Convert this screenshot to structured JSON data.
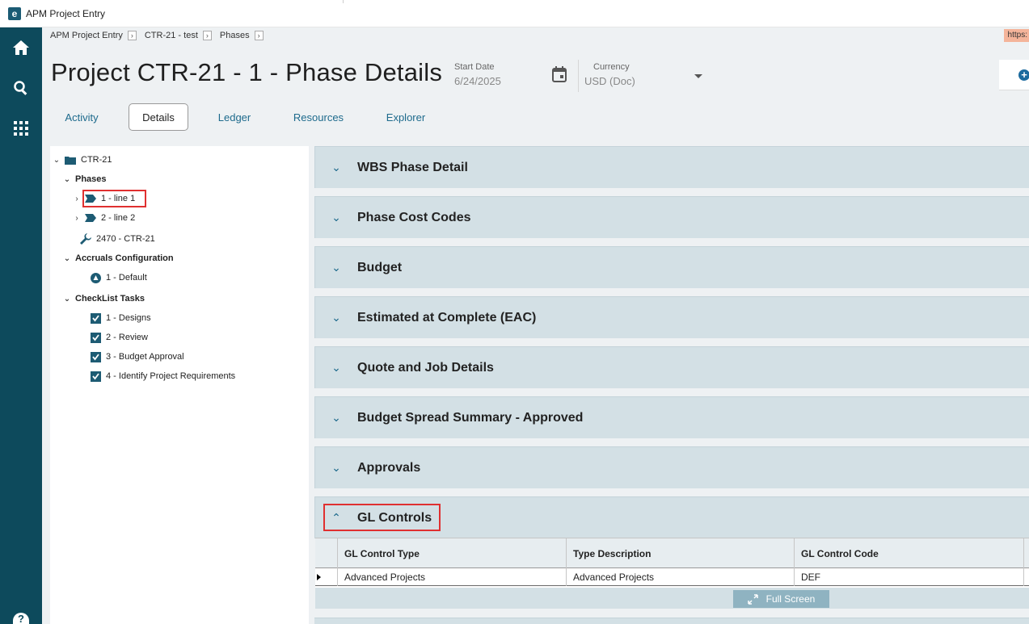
{
  "window": {
    "title": "APM Project Entry",
    "app_icon": "e"
  },
  "rail": {
    "items": [
      "home-icon",
      "search-icon",
      "apps-grid-icon"
    ],
    "help": "?"
  },
  "breadcrumb": [
    {
      "label": "APM Project Entry"
    },
    {
      "label": "CTR-21 - test"
    },
    {
      "label": "Phases"
    }
  ],
  "url_badge": "https:",
  "page_title": "Project CTR-21 - 1 - Phase Details",
  "start_date": {
    "label": "Start Date",
    "value": "6/24/2025"
  },
  "currency": {
    "label": "Currency",
    "value": "USD (Doc)"
  },
  "tabs": [
    {
      "label": "Activity",
      "active": false
    },
    {
      "label": "Details",
      "active": true
    },
    {
      "label": "Ledger",
      "active": false
    },
    {
      "label": "Resources",
      "active": false
    },
    {
      "label": "Explorer",
      "active": false
    }
  ],
  "tree": {
    "root": "CTR-21",
    "phases_label": "Phases",
    "phases": [
      "1 - line 1",
      "2 - line 2"
    ],
    "tool": "2470 - CTR-21",
    "accruals_label": "Accruals Configuration",
    "accruals": [
      "1 - Default"
    ],
    "checklist_label": "CheckList Tasks",
    "checklist": [
      "1 - Designs",
      "2 - Review",
      "3 - Budget Approval",
      "4 - Identify Project Requirements"
    ]
  },
  "sections": [
    {
      "label": "WBS Phase Detail",
      "expanded": false
    },
    {
      "label": "Phase Cost Codes",
      "expanded": false
    },
    {
      "label": "Budget",
      "expanded": false
    },
    {
      "label": "Estimated at Complete (EAC)",
      "expanded": false
    },
    {
      "label": "Quote and Job Details",
      "expanded": false
    },
    {
      "label": "Budget Spread Summary - Approved",
      "expanded": false
    },
    {
      "label": "Approvals",
      "expanded": false
    },
    {
      "label": "GL Controls",
      "expanded": true
    }
  ],
  "gl_grid": {
    "columns": [
      "GL Control Type",
      "Type Description",
      "GL Control Code"
    ],
    "rows": [
      [
        "Advanced Projects",
        "Advanced Projects",
        "DEF"
      ]
    ],
    "fullscreen_label": "Full Screen"
  },
  "colors": {
    "rail": "#0d4a5c",
    "accent": "#1d6a8c",
    "section_bg": "#d3e0e5",
    "highlight": "#e03030"
  }
}
